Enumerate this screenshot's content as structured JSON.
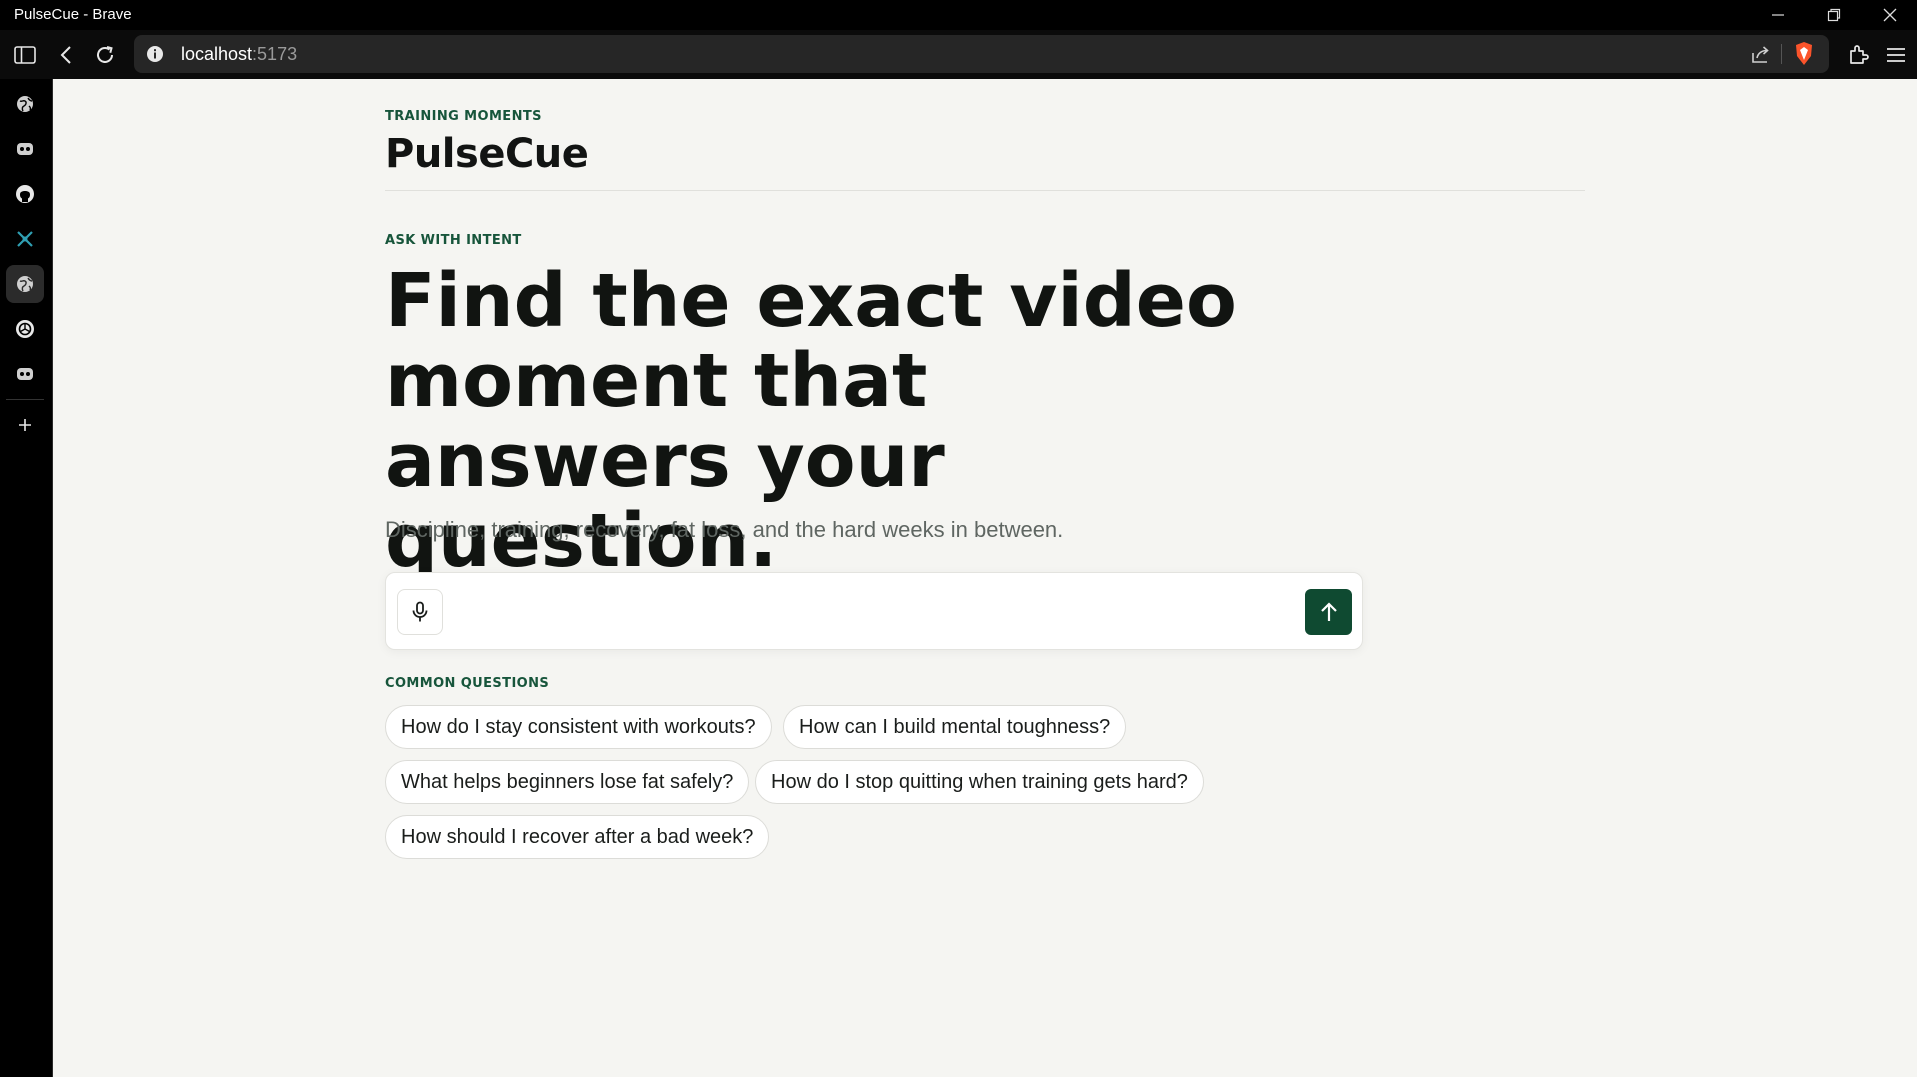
{
  "window": {
    "title": "PulseCue - Brave"
  },
  "browser": {
    "url_host": "localhost",
    "url_port": ":5173"
  },
  "sidebar": {
    "items": [
      {
        "icon": "globe-icon"
      },
      {
        "icon": "copilot-icon"
      },
      {
        "icon": "github-icon"
      },
      {
        "icon": "perplexity-icon"
      },
      {
        "icon": "globe-icon",
        "active": true
      },
      {
        "icon": "openai-icon"
      },
      {
        "icon": "copilot-icon"
      }
    ]
  },
  "header": {
    "eyebrow": "TRAINING MOMENTS",
    "brand": "PulseCue"
  },
  "hero": {
    "eyebrow": "ASK WITH INTENT",
    "headline": "Find the exact video moment that answers your question.",
    "subtitle": "Discipline, training, recovery, fat loss, and the hard weeks in between."
  },
  "search": {
    "value": "",
    "placeholder": ""
  },
  "common": {
    "eyebrow": "COMMON QUESTIONS",
    "questions": [
      "How do I stay consistent with workouts?",
      "How can I build mental toughness?",
      "What helps beginners lose fat safely?",
      "How do I stop quitting when training gets hard?",
      "How should I recover after a bad week?"
    ]
  },
  "colors": {
    "accent": "#0f4a31",
    "eyebrow": "#17553b",
    "page_bg": "#f5f5f2"
  }
}
